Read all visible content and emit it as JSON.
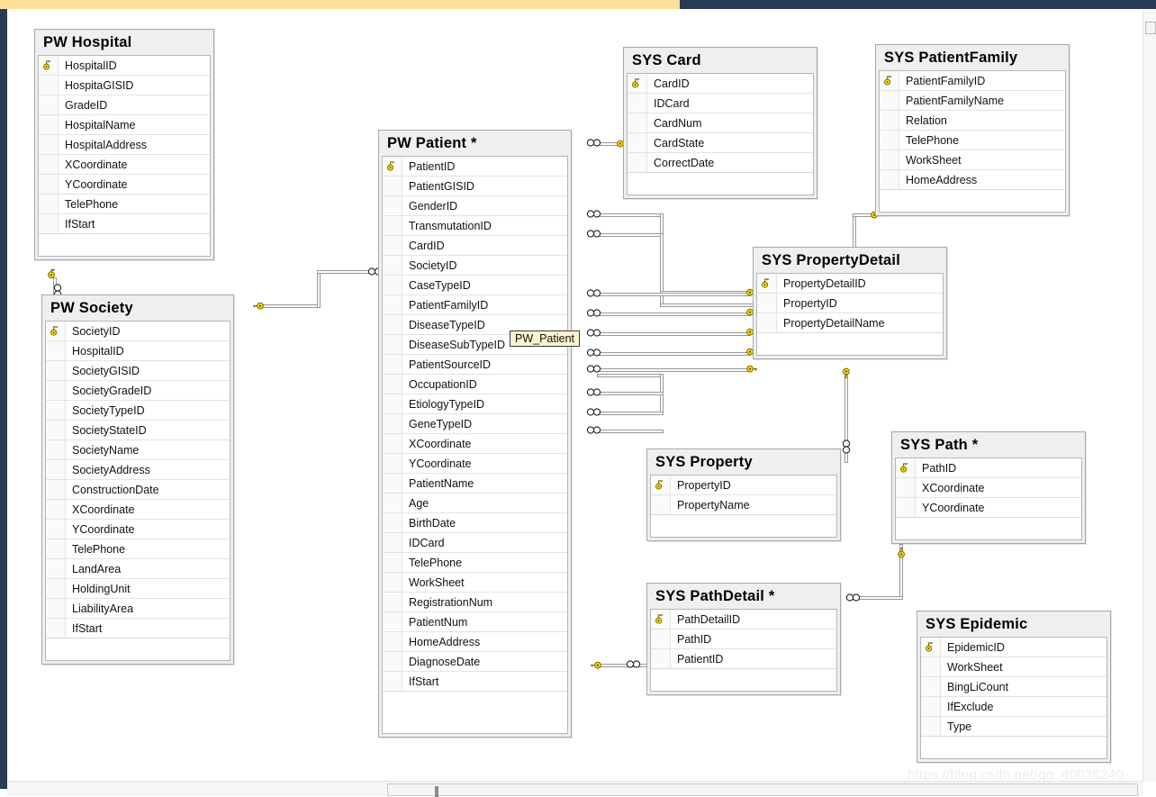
{
  "app": {
    "watermark": "https://blog.csdn.net/qq_40036240",
    "tooltip": "PW_Patient",
    "accent_top": "#ffe09a",
    "chrome_dark": "#2b3a55",
    "entity_header_bg": "#efefef",
    "key_color": "#ffd800"
  },
  "icons": {
    "primary_key": "key-icon",
    "many_end": "infinity-icon",
    "one_end": "key-icon"
  },
  "entities": [
    {
      "id": "pw-hospital",
      "title": "PW Hospital",
      "fields": [
        {
          "name": "HospitalID",
          "pk": true
        },
        {
          "name": "HospitaGISID",
          "pk": false
        },
        {
          "name": "GradeID",
          "pk": false
        },
        {
          "name": "HospitalName",
          "pk": false
        },
        {
          "name": "HospitalAddress",
          "pk": false
        },
        {
          "name": "XCoordinate",
          "pk": false
        },
        {
          "name": "YCoordinate",
          "pk": false
        },
        {
          "name": "TelePhone",
          "pk": false
        },
        {
          "name": "IfStart",
          "pk": false
        }
      ]
    },
    {
      "id": "pw-society",
      "title": "PW Society",
      "fields": [
        {
          "name": "SocietyID",
          "pk": true
        },
        {
          "name": "HospitalID",
          "pk": false
        },
        {
          "name": "SocietyGISID",
          "pk": false
        },
        {
          "name": "SocietyGradeID",
          "pk": false
        },
        {
          "name": "SocietyTypeID",
          "pk": false
        },
        {
          "name": "SocietyStateID",
          "pk": false
        },
        {
          "name": "SocietyName",
          "pk": false
        },
        {
          "name": "SocietyAddress",
          "pk": false
        },
        {
          "name": "ConstructionDate",
          "pk": false
        },
        {
          "name": "XCoordinate",
          "pk": false
        },
        {
          "name": "YCoordinate",
          "pk": false
        },
        {
          "name": "TelePhone",
          "pk": false
        },
        {
          "name": "LandArea",
          "pk": false
        },
        {
          "name": "HoldingUnit",
          "pk": false
        },
        {
          "name": "LiabilityArea",
          "pk": false
        },
        {
          "name": "IfStart",
          "pk": false
        }
      ]
    },
    {
      "id": "pw-patient",
      "title": "PW Patient *",
      "fields": [
        {
          "name": "PatientID",
          "pk": true
        },
        {
          "name": "PatientGISID",
          "pk": false
        },
        {
          "name": "GenderID",
          "pk": false
        },
        {
          "name": "TransmutationID",
          "pk": false
        },
        {
          "name": "CardID",
          "pk": false
        },
        {
          "name": "SocietyID",
          "pk": false
        },
        {
          "name": "CaseTypeID",
          "pk": false
        },
        {
          "name": "PatientFamilyID",
          "pk": false
        },
        {
          "name": "DiseaseTypeID",
          "pk": false
        },
        {
          "name": "DiseaseSubTypeID",
          "pk": false
        },
        {
          "name": "PatientSourceID",
          "pk": false
        },
        {
          "name": "OccupationID",
          "pk": false
        },
        {
          "name": "EtiologyTypeID",
          "pk": false
        },
        {
          "name": "GeneTypeID",
          "pk": false
        },
        {
          "name": "XCoordinate",
          "pk": false
        },
        {
          "name": "YCoordinate",
          "pk": false
        },
        {
          "name": "PatientName",
          "pk": false
        },
        {
          "name": "Age",
          "pk": false
        },
        {
          "name": "BirthDate",
          "pk": false
        },
        {
          "name": "IDCard",
          "pk": false
        },
        {
          "name": "TelePhone",
          "pk": false
        },
        {
          "name": "WorkSheet",
          "pk": false
        },
        {
          "name": "RegistrationNum",
          "pk": false
        },
        {
          "name": "PatientNum",
          "pk": false
        },
        {
          "name": "HomeAddress",
          "pk": false
        },
        {
          "name": "DiagnoseDate",
          "pk": false
        },
        {
          "name": "IfStart",
          "pk": false
        }
      ]
    },
    {
      "id": "sys-card",
      "title": "SYS Card",
      "fields": [
        {
          "name": "CardID",
          "pk": true
        },
        {
          "name": "IDCard",
          "pk": false
        },
        {
          "name": "CardNum",
          "pk": false
        },
        {
          "name": "CardState",
          "pk": false
        },
        {
          "name": "CorrectDate",
          "pk": false
        }
      ]
    },
    {
      "id": "sys-patientfamily",
      "title": "SYS PatientFamily",
      "fields": [
        {
          "name": "PatientFamilyID",
          "pk": true
        },
        {
          "name": "PatientFamilyName",
          "pk": false
        },
        {
          "name": "Relation",
          "pk": false
        },
        {
          "name": "TelePhone",
          "pk": false
        },
        {
          "name": "WorkSheet",
          "pk": false
        },
        {
          "name": "HomeAddress",
          "pk": false
        }
      ]
    },
    {
      "id": "sys-propertydetail",
      "title": "SYS PropertyDetail",
      "fields": [
        {
          "name": "PropertyDetailID",
          "pk": true
        },
        {
          "name": "PropertyID",
          "pk": false
        },
        {
          "name": "PropertyDetailName",
          "pk": false
        }
      ]
    },
    {
      "id": "sys-property",
      "title": "SYS Property",
      "fields": [
        {
          "name": "PropertyID",
          "pk": true
        },
        {
          "name": "PropertyName",
          "pk": false
        }
      ]
    },
    {
      "id": "sys-path",
      "title": "SYS Path *",
      "fields": [
        {
          "name": "PathID",
          "pk": true
        },
        {
          "name": "XCoordinate",
          "pk": false
        },
        {
          "name": "YCoordinate",
          "pk": false
        }
      ]
    },
    {
      "id": "sys-pathdetail",
      "title": "SYS PathDetail *",
      "fields": [
        {
          "name": "PathDetailID",
          "pk": true
        },
        {
          "name": "PathID",
          "pk": false
        },
        {
          "name": "PatientID",
          "pk": false
        }
      ]
    },
    {
      "id": "sys-epidemic",
      "title": "SYS Epidemic",
      "fields": [
        {
          "name": "EpidemicID",
          "pk": true
        },
        {
          "name": "WorkSheet",
          "pk": false
        },
        {
          "name": "BingLiCount",
          "pk": false
        },
        {
          "name": "IfExclude",
          "pk": false
        },
        {
          "name": "Type",
          "pk": false
        }
      ]
    }
  ],
  "relationships": [
    {
      "from": "pw-hospital",
      "to": "pw-society",
      "from_end": "one",
      "to_end": "many"
    },
    {
      "from": "pw-society",
      "to": "pw-patient",
      "from_end": "one",
      "to_end": "many"
    },
    {
      "from": "sys-card",
      "to": "pw-patient",
      "from_end": "one",
      "to_end": "many"
    },
    {
      "from": "sys-patientfamily",
      "to": "pw-patient",
      "from_end": "one",
      "to_end": "many"
    },
    {
      "from": "sys-propertydetail",
      "to": "pw-patient",
      "from_end": "one",
      "to_end": "many"
    },
    {
      "from": "sys-property",
      "to": "sys-propertydetail",
      "from_end": "one",
      "to_end": "many"
    },
    {
      "from": "sys-path",
      "to": "sys-pathdetail",
      "from_end": "one",
      "to_end": "many"
    },
    {
      "from": "pw-patient",
      "to": "sys-pathdetail",
      "from_end": "one",
      "to_end": "many"
    }
  ]
}
